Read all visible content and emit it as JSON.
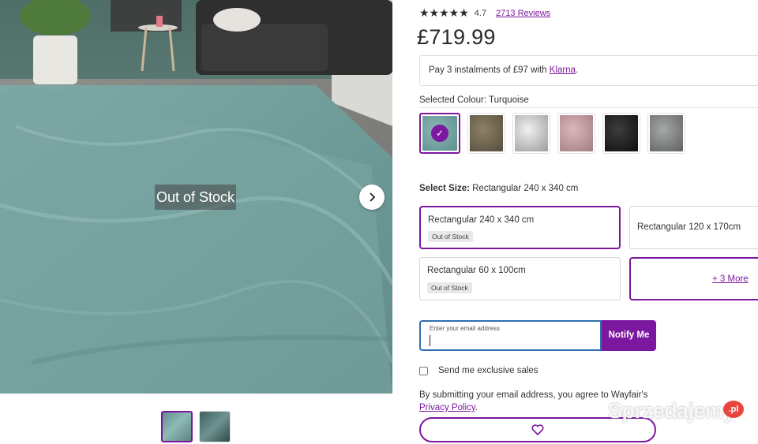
{
  "gallery": {
    "overlay_text": "Out of Stock",
    "thumbnails": [
      {
        "name": "turquoise-rug-front",
        "active": true
      },
      {
        "name": "turquoise-rug-closeup",
        "active": false
      }
    ]
  },
  "product": {
    "rating": 4.7,
    "rating_text": "4.7",
    "stars": "★★★★★",
    "reviews_text": "2713 Reviews",
    "price": "£719.99"
  },
  "klarna": {
    "prefix": "Pay 3 instalments of £97 with ",
    "link": "Klarna",
    "suffix": "."
  },
  "colour": {
    "label_prefix": "Selected Colour: ",
    "selected": "Turquoise",
    "swatches": [
      {
        "name": "turquoise",
        "color": "#6b9c9c",
        "selected": true
      },
      {
        "name": "taupe",
        "color": "#6e6450",
        "selected": false
      },
      {
        "name": "white",
        "color": "#d8d8d8",
        "selected": false
      },
      {
        "name": "rose",
        "color": "#c59ea4",
        "selected": false
      },
      {
        "name": "black",
        "color": "#222222",
        "selected": false
      },
      {
        "name": "grey",
        "color": "#8a8c8c",
        "selected": false
      }
    ]
  },
  "size": {
    "label_bold": "Select Size:",
    "label_value": " Rectangular 240 x 340 cm",
    "options": [
      {
        "name": "Rectangular 240 x 340 cm",
        "badge": "Out of Stock",
        "selected": true
      },
      {
        "name": "Rectangular 120 x 170cm",
        "badge": "",
        "selected": false
      },
      {
        "name": "Rectangular 60 x 100cm",
        "badge": "Out of Stock",
        "selected": false
      }
    ],
    "more_text": "+ 3 More"
  },
  "notify": {
    "placeholder": "Enter your email address",
    "value": "",
    "button": "Notify Me"
  },
  "optin_text": "Send me exclusive sales",
  "legal": {
    "text": "By submitting your email address, you agree to Wayfair's ",
    "link": "Privacy Policy",
    "suffix": "."
  },
  "favorite_icon": "heart-icon",
  "watermark": {
    "text": "Sprzedajemy",
    "badge": ".pl"
  },
  "colors": {
    "accent": "#7b189f",
    "focus": "#2f6fb0"
  }
}
